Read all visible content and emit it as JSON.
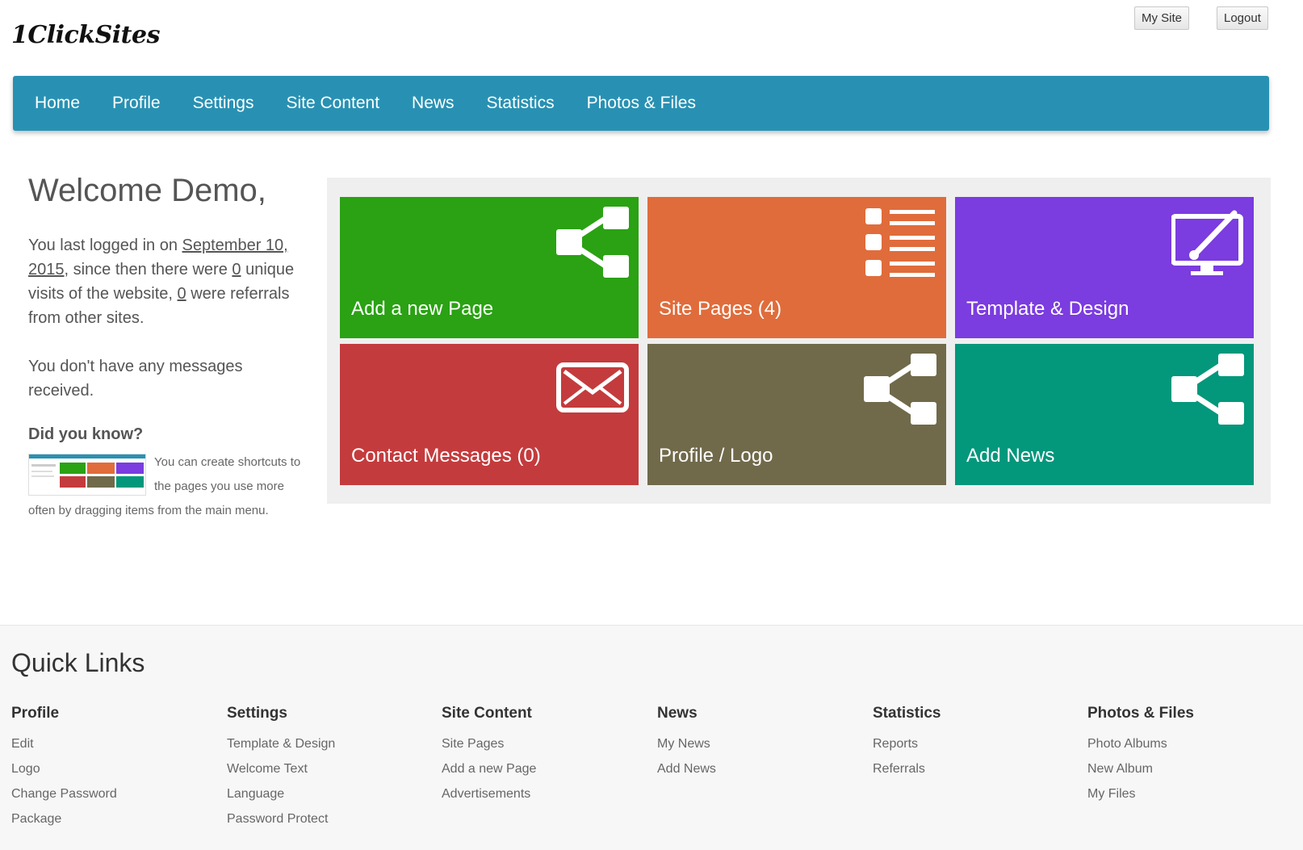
{
  "header": {
    "logo_text": "1ClickSites",
    "my_site": "My Site",
    "logout": "Logout"
  },
  "nav": [
    "Home",
    "Profile",
    "Settings",
    "Site Content",
    "News",
    "Statistics",
    "Photos & Files"
  ],
  "welcome": {
    "title": "Welcome Demo,",
    "last_login_prefix": "You last logged in on ",
    "last_login_date": "September 10, 2015",
    "since_text": ", since then there were ",
    "visits": "0",
    "visits_text": " unique visits of the website, ",
    "referrals": "0",
    "referrals_text": " were referrals from other sites.",
    "messages": "You don't have any messages received.",
    "did_you_know_title": "Did you know?",
    "did_you_know_text": "You can create shortcuts to the pages you use more often by dragging items from the main menu."
  },
  "tiles": [
    {
      "label": "Add a new Page",
      "color": "#2aa213",
      "icon": "share-icon"
    },
    {
      "label": "Site Pages (4)",
      "color": "#e06c3b",
      "icon": "list-icon"
    },
    {
      "label": "Template & Design",
      "color": "#7b3ce0",
      "icon": "monitor-brush-icon"
    },
    {
      "label": "Contact Messages (0)",
      "color": "#c43b3d",
      "icon": "envelope-icon"
    },
    {
      "label": "Profile / Logo",
      "color": "#706a4b",
      "icon": "share-icon"
    },
    {
      "label": "Add News",
      "color": "#03977c",
      "icon": "share-icon"
    }
  ],
  "quick_links": {
    "title": "Quick Links",
    "columns": [
      {
        "title": "Profile",
        "links": [
          "Edit",
          "Logo",
          "Change Password",
          "Package"
        ]
      },
      {
        "title": "Settings",
        "links": [
          "Template & Design",
          "Welcome Text",
          "Language",
          "Password Protect"
        ]
      },
      {
        "title": "Site Content",
        "links": [
          "Site Pages",
          "Add a new Page",
          "Advertisements"
        ]
      },
      {
        "title": "News",
        "links": [
          "My News",
          "Add News"
        ]
      },
      {
        "title": "Statistics",
        "links": [
          "Reports",
          "Referrals"
        ]
      },
      {
        "title": "Photos & Files",
        "links": [
          "Photo Albums",
          "New Album",
          "My Files"
        ]
      }
    ]
  }
}
